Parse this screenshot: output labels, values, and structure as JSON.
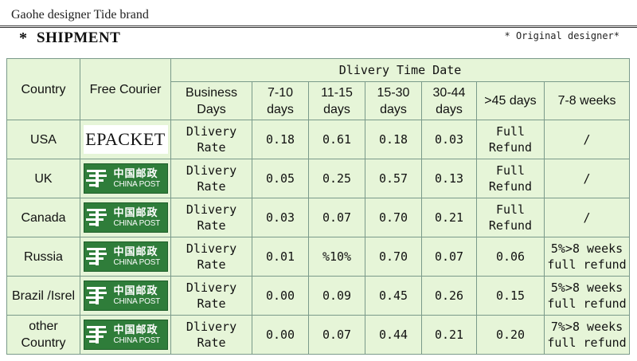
{
  "header": {
    "brand": "Gaohe designer Tide brand",
    "star": "*",
    "title": "SHIPMENT",
    "designer_note": "* Original designer*"
  },
  "table": {
    "col_country": "Country",
    "col_courier": "Free Courier",
    "group_header": "Dlivery Time Date",
    "sub_headers": {
      "business_days": "Business Days",
      "d7_10": "7-10 days",
      "d11_15": "11-15 days",
      "d15_30": "15-30 days",
      "d30_44": "30-44 days",
      "d45": ">45 days",
      "w7_8": "7-8 weeks"
    },
    "epacket_label": "EPACKET",
    "china_post_cn": "中国邮政",
    "china_post_en": "CHINA POST",
    "rate_line1": "Dlivery",
    "rate_line2": "Rate",
    "rows": [
      {
        "country": "USA",
        "courier": "epacket",
        "v7_10": "0.18",
        "v11_15": "0.61",
        "v15_30": "0.18",
        "v30_44": "0.03",
        "v45_line1": "Full",
        "v45_line2": "Refund",
        "w7_8_line1": "/",
        "w7_8_line2": ""
      },
      {
        "country": "UK",
        "courier": "china-post",
        "v7_10": "0.05",
        "v11_15": "0.25",
        "v15_30": "0.57",
        "v30_44": "0.13",
        "v45_line1": "Full",
        "v45_line2": "Refund",
        "w7_8_line1": "/",
        "w7_8_line2": ""
      },
      {
        "country": "Canada",
        "courier": "china-post",
        "v7_10": "0.03",
        "v11_15": "0.07",
        "v15_30": "0.70",
        "v30_44": "0.21",
        "v45_line1": "Full",
        "v45_line2": "Refund",
        "w7_8_line1": "/",
        "w7_8_line2": ""
      },
      {
        "country": "Russia",
        "courier": "china-post",
        "v7_10": "0.01",
        "v11_15": "%10%",
        "v15_30": "0.70",
        "v30_44": "0.07",
        "v45_line1": "0.06",
        "v45_line2": "",
        "w7_8_line1": "5%>8 weeks",
        "w7_8_line2": "full refund"
      },
      {
        "country": "Brazil /Isrel",
        "courier": "china-post",
        "v7_10": "0.00",
        "v11_15": "0.09",
        "v15_30": "0.45",
        "v30_44": "0.26",
        "v45_line1": "0.15",
        "v45_line2": "",
        "w7_8_line1": "5%>8 weeks",
        "w7_8_line2": "full refund"
      },
      {
        "country": "other Country",
        "courier": "china-post",
        "v7_10": "0.00",
        "v11_15": "0.07",
        "v15_30": "0.44",
        "v30_44": "0.21",
        "v45_line1": "0.20",
        "v45_line2": "",
        "w7_8_line1": "7%>8 weeks",
        "w7_8_line2": "full refund"
      }
    ]
  },
  "colors": {
    "table_bg": "#e6f5d8",
    "border": "#7a9a8a",
    "china_post_green": "#2f7d3a"
  }
}
